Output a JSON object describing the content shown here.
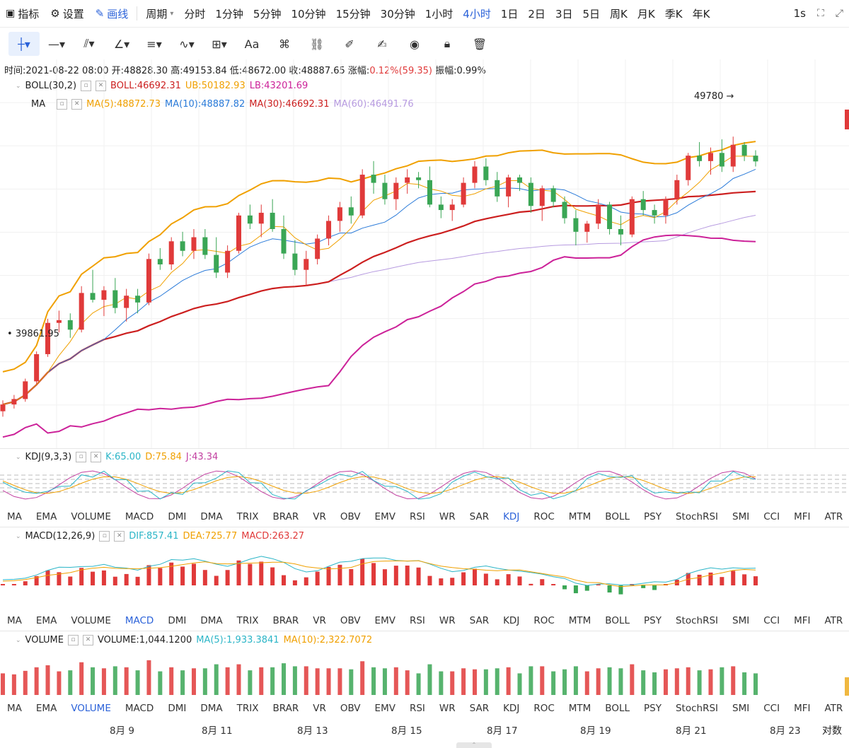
{
  "toolbar": {
    "indicators": "指标",
    "settings": "设置",
    "drawing": "画线",
    "period": "周期",
    "intervals": [
      "分时",
      "1分钟",
      "5分钟",
      "10分钟",
      "15分钟",
      "30分钟",
      "1小时",
      "4小时",
      "1日",
      "2日",
      "3日",
      "5日",
      "周K",
      "月K",
      "季K",
      "年K"
    ],
    "active_interval": "4小时",
    "speed": "1s"
  },
  "info": {
    "time": "时间:2021-08-22 08:00",
    "open": "开:48828.30",
    "high": "高:49153.84",
    "low": "低:48672.00",
    "close": "收:48887.65",
    "change_label": "涨幅:",
    "change": "0.12%(59.35)",
    "amplitude": "振幅:0.99%"
  },
  "boll": {
    "name": "BOLL(30,2)",
    "mid": "BOLL:46692.31",
    "ub": "UB:50182.93",
    "lb": "LB:43201.69"
  },
  "ma": {
    "name": "MA",
    "ma5": "MA(5):48872.73",
    "ma10": "MA(10):48887.82",
    "ma30": "MA(30):46692.31",
    "ma60": "MA(60):46491.76"
  },
  "kdj": {
    "name": "KDJ(9,3,3)",
    "k": "K:65.00",
    "d": "D:75.84",
    "j": "J:43.34"
  },
  "macd": {
    "name": "MACD(12,26,9)",
    "dif": "DIF:857.41",
    "dea": "DEA:725.77",
    "macd": "MACD:263.27"
  },
  "volume": {
    "name": "VOLUME",
    "vol": "VOLUME:1,044.1200",
    "ma5": "MA(5):1,933.3841",
    "ma10": "MA(10):2,322.7072"
  },
  "annotations": {
    "high": "49780",
    "low": "39861.95"
  },
  "indicator_tabs": [
    "MA",
    "EMA",
    "VOLUME",
    "MACD",
    "DMI",
    "DMA",
    "TRIX",
    "BRAR",
    "VR",
    "OBV",
    "EMV",
    "RSI",
    "WR",
    "SAR",
    "KDJ",
    "ROC",
    "MTM",
    "BOLL",
    "PSY",
    "StochRSI",
    "SMI",
    "CCI",
    "MFI",
    "ATR",
    "BBW"
  ],
  "indicator_active": {
    "bar1": "KDJ",
    "bar2": "MACD",
    "bar3": "VOLUME"
  },
  "dates": [
    "8月 9",
    "8月 11",
    "8月 13",
    "8月 15",
    "8月 17",
    "8月 19",
    "8月 21",
    "8月 23"
  ],
  "corner": "对数",
  "colors": {
    "up": "#e03a3a",
    "down": "#3aa655",
    "boll_up": "#f0a000",
    "boll_mid": "#cc1f1f",
    "boll_low": "#cc2299",
    "ma60": "#b79be0",
    "accent": "#2b62d9"
  },
  "chart_data": {
    "type": "candlestick",
    "price_range": [
      38600,
      51600
    ],
    "candles": [
      [
        39700,
        40100,
        39500,
        39950
      ],
      [
        39950,
        40300,
        39800,
        40150
      ],
      [
        40150,
        40900,
        40050,
        40800
      ],
      [
        40800,
        41900,
        40700,
        41800
      ],
      [
        41800,
        43100,
        41700,
        42950
      ],
      [
        42950,
        43400,
        42600,
        43050
      ],
      [
        43050,
        43300,
        42400,
        42700
      ],
      [
        42700,
        44300,
        42600,
        44050
      ],
      [
        44050,
        44900,
        43700,
        43800
      ],
      [
        43800,
        44300,
        43200,
        44150
      ],
      [
        44150,
        44600,
        43300,
        43500
      ],
      [
        43500,
        44200,
        43000,
        43950
      ],
      [
        43950,
        44200,
        43300,
        43700
      ],
      [
        43700,
        45500,
        43600,
        45300
      ],
      [
        45300,
        45700,
        44900,
        45100
      ],
      [
        45100,
        46100,
        44900,
        45950
      ],
      [
        45950,
        46300,
        45400,
        45600
      ],
      [
        45600,
        46400,
        45300,
        46100
      ],
      [
        46100,
        46400,
        45300,
        45450
      ],
      [
        45450,
        46100,
        44600,
        44800
      ],
      [
        44800,
        45800,
        44600,
        45600
      ],
      [
        45600,
        47000,
        45500,
        46900
      ],
      [
        46900,
        47300,
        46400,
        46600
      ],
      [
        46600,
        47300,
        46100,
        47000
      ],
      [
        47000,
        47500,
        46300,
        46400
      ],
      [
        46400,
        46900,
        45300,
        45500
      ],
      [
        45500,
        46000,
        44700,
        44900
      ],
      [
        44900,
        45600,
        44300,
        45300
      ],
      [
        45300,
        46200,
        45100,
        46050
      ],
      [
        46050,
        46900,
        45800,
        46700
      ],
      [
        46700,
        47400,
        46300,
        47200
      ],
      [
        47200,
        47600,
        46600,
        46900
      ],
      [
        46900,
        48600,
        46800,
        48400
      ],
      [
        48400,
        48900,
        47700,
        48100
      ],
      [
        48100,
        48400,
        47300,
        47500
      ],
      [
        47500,
        48300,
        47100,
        48100
      ],
      [
        48100,
        48600,
        47700,
        48300
      ],
      [
        48300,
        48500,
        47900,
        48200
      ],
      [
        48200,
        48700,
        47200,
        47300
      ],
      [
        47300,
        47600,
        46800,
        47100
      ],
      [
        47100,
        47500,
        46700,
        47300
      ],
      [
        47300,
        48300,
        47200,
        48100
      ],
      [
        48100,
        48900,
        47900,
        48700
      ],
      [
        48700,
        49000,
        48000,
        48200
      ],
      [
        48200,
        48500,
        47400,
        47600
      ],
      [
        47600,
        48400,
        47200,
        48300
      ],
      [
        48300,
        48400,
        47800,
        48100
      ],
      [
        48100,
        48300,
        47000,
        47250
      ],
      [
        47250,
        48000,
        46700,
        47900
      ],
      [
        47900,
        48000,
        47200,
        47400
      ],
      [
        47400,
        47600,
        46600,
        46800
      ],
      [
        46800,
        47100,
        45800,
        46300
      ],
      [
        46300,
        46700,
        45900,
        46600
      ],
      [
        46600,
        47500,
        46400,
        47300
      ],
      [
        47300,
        47400,
        46200,
        46400
      ],
      [
        46400,
        46900,
        45800,
        46200
      ],
      [
        46200,
        47600,
        46100,
        47500
      ],
      [
        47500,
        47800,
        46900,
        47100
      ],
      [
        47100,
        47300,
        46600,
        46900
      ],
      [
        46900,
        47600,
        46600,
        47500
      ],
      [
        47500,
        48400,
        47300,
        48200
      ],
      [
        48200,
        49200,
        48000,
        49100
      ],
      [
        49100,
        49600,
        48700,
        48900
      ],
      [
        48900,
        49400,
        48400,
        49200
      ],
      [
        49200,
        49700,
        48500,
        48700
      ],
      [
        48700,
        49800,
        48500,
        49500
      ],
      [
        49500,
        49600,
        48900,
        49100
      ],
      [
        49100,
        49300,
        48700,
        48888
      ]
    ]
  }
}
